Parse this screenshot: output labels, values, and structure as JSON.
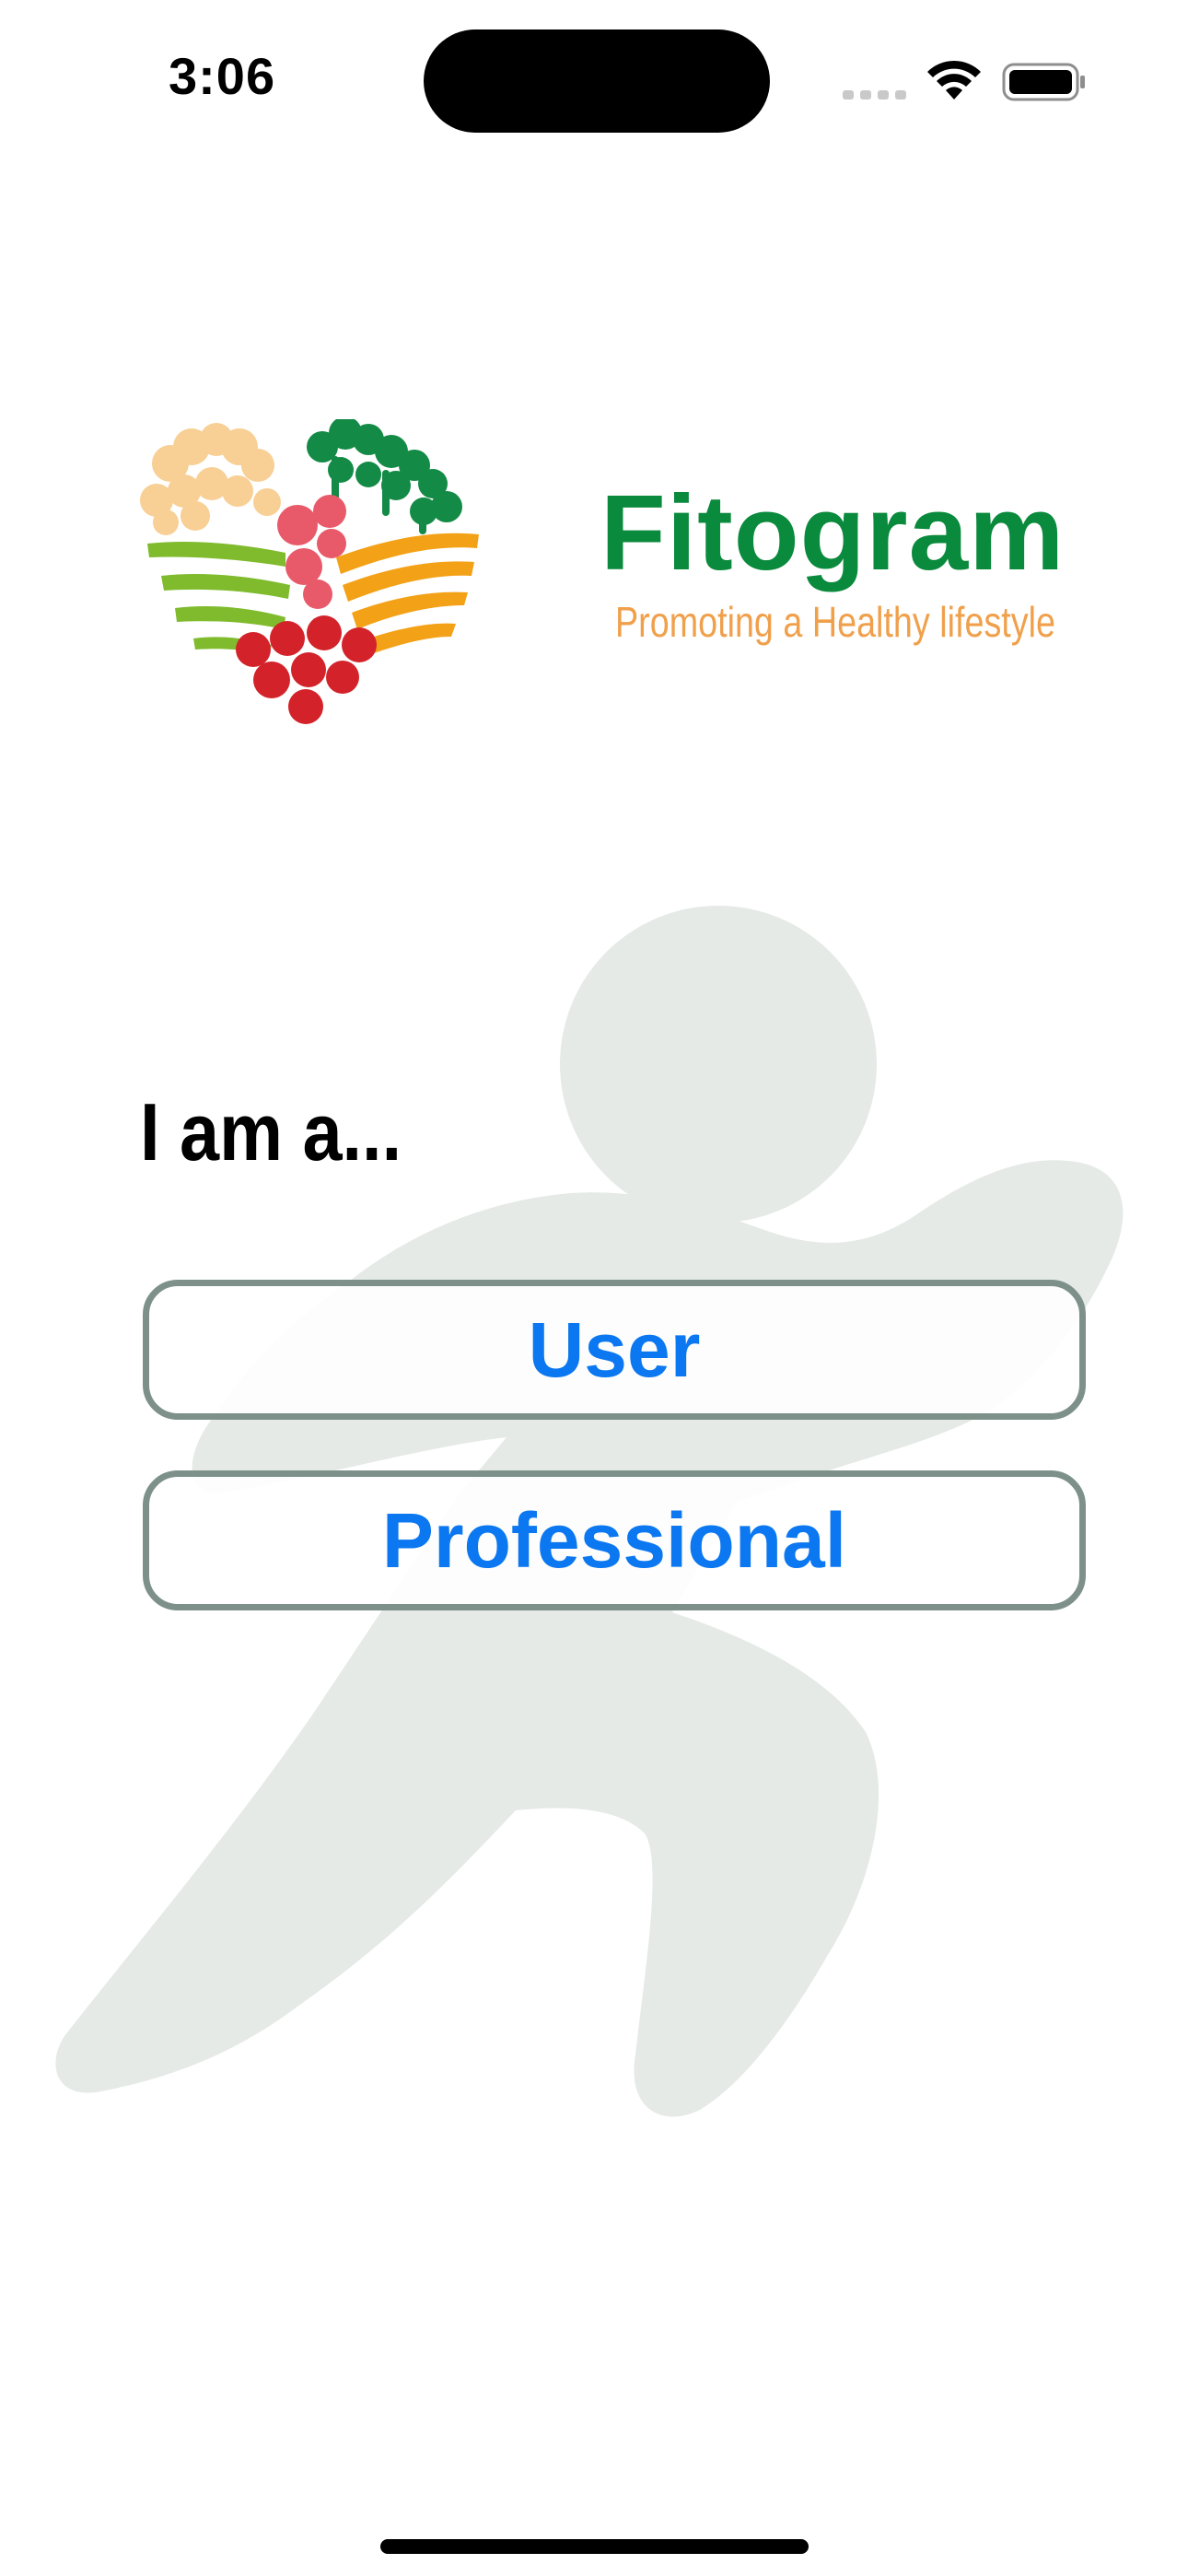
{
  "status_bar": {
    "time": "3:06",
    "icons": [
      "cellular-signal-icon",
      "wifi-icon",
      "battery-icon"
    ]
  },
  "logo": {
    "brand_name": "Fitogram",
    "tagline": "Promoting a Healthy lifestyle"
  },
  "prompt": {
    "heading": "I am a..."
  },
  "role_options": [
    {
      "label": "User"
    },
    {
      "label": "Professional"
    }
  ],
  "colors": {
    "brand_green": "#0a8a3c",
    "tagline_orange": "#f0a04b",
    "button_text_blue": "#0b77f0",
    "button_border": "#7d918a",
    "runner_figure": "#e5eae7"
  }
}
